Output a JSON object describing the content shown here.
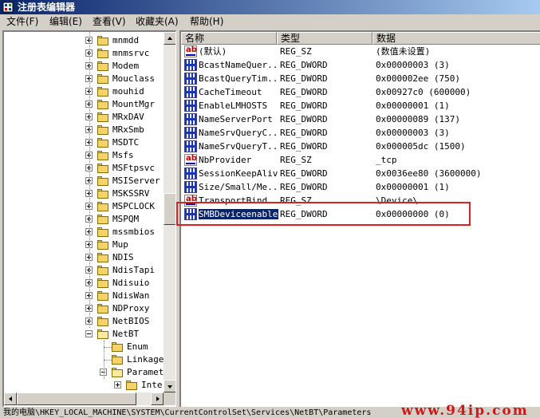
{
  "window": {
    "title": "注册表编辑器",
    "app_icon": "regedit-icon"
  },
  "menu": [
    "文件(F)",
    "编辑(E)",
    "查看(V)",
    "收藏夹(A)",
    "帮助(H)"
  ],
  "tree": {
    "items": [
      {
        "label": "mnmdd",
        "expander": "plus"
      },
      {
        "label": "mnmsrvc",
        "expander": "plus"
      },
      {
        "label": "Modem",
        "expander": "plus"
      },
      {
        "label": "Mouclass",
        "expander": "plus"
      },
      {
        "label": "mouhid",
        "expander": "plus"
      },
      {
        "label": "MountMgr",
        "expander": "plus"
      },
      {
        "label": "MRxDAV",
        "expander": "plus"
      },
      {
        "label": "MRxSmb",
        "expander": "plus"
      },
      {
        "label": "MSDTC",
        "expander": "plus"
      },
      {
        "label": "Msfs",
        "expander": "plus"
      },
      {
        "label": "MSFtpsvc",
        "expander": "plus"
      },
      {
        "label": "MSIServer",
        "expander": "plus"
      },
      {
        "label": "MSKSSRV",
        "expander": "plus"
      },
      {
        "label": "MSPCLOCK",
        "expander": "plus"
      },
      {
        "label": "MSPQM",
        "expander": "plus"
      },
      {
        "label": "mssmbios",
        "expander": "plus"
      },
      {
        "label": "Mup",
        "expander": "plus"
      },
      {
        "label": "NDIS",
        "expander": "plus"
      },
      {
        "label": "NdisTapi",
        "expander": "plus"
      },
      {
        "label": "Ndisuio",
        "expander": "plus"
      },
      {
        "label": "NdisWan",
        "expander": "plus"
      },
      {
        "label": "NDProxy",
        "expander": "plus"
      },
      {
        "label": "NetBIOS",
        "expander": "plus"
      },
      {
        "label": "NetBT",
        "expander": "minus"
      }
    ],
    "netbt_children": [
      {
        "label": "Enum",
        "expander": "none"
      },
      {
        "label": "Linkage",
        "expander": "none"
      },
      {
        "label": "Paramet",
        "expander": "minus"
      }
    ],
    "param_children": [
      {
        "label": "Inte",
        "expander": "plus"
      }
    ]
  },
  "list": {
    "columns": [
      "名称",
      "类型",
      "数据"
    ],
    "rows": [
      {
        "icon": "string-value-icon",
        "name": "(默认)",
        "type": "REG_SZ",
        "data": "(数值未设置)"
      },
      {
        "icon": "dword-value-icon",
        "name": "BcastNameQuer...",
        "type": "REG_DWORD",
        "data": "0x00000003 (3)"
      },
      {
        "icon": "dword-value-icon",
        "name": "BcastQueryTim...",
        "type": "REG_DWORD",
        "data": "0x000002ee (750)"
      },
      {
        "icon": "dword-value-icon",
        "name": "CacheTimeout",
        "type": "REG_DWORD",
        "data": "0x00927c0 (600000)"
      },
      {
        "icon": "dword-value-icon",
        "name": "EnableLMHOSTS",
        "type": "REG_DWORD",
        "data": "0x00000001 (1)"
      },
      {
        "icon": "dword-value-icon",
        "name": "NameServerPort",
        "type": "REG_DWORD",
        "data": "0x00000089 (137)"
      },
      {
        "icon": "dword-value-icon",
        "name": "NameSrvQueryC...",
        "type": "REG_DWORD",
        "data": "0x00000003 (3)"
      },
      {
        "icon": "dword-value-icon",
        "name": "NameSrvQueryT...",
        "type": "REG_DWORD",
        "data": "0x000005dc (1500)"
      },
      {
        "icon": "string-value-icon",
        "name": "NbProvider",
        "type": "REG_SZ",
        "data": "_tcp"
      },
      {
        "icon": "dword-value-icon",
        "name": "SessionKeepAlive",
        "type": "REG_DWORD",
        "data": "0x0036ee80 (3600000)"
      },
      {
        "icon": "dword-value-icon",
        "name": "Size/Small/Me...",
        "type": "REG_DWORD",
        "data": "0x00000001 (1)"
      },
      {
        "icon": "string-value-icon",
        "name": "TransportBind...",
        "type": "REG_SZ",
        "data": "\\Device\\"
      },
      {
        "icon": "dword-value-icon",
        "name": "SMBDeviceenabled",
        "type": "REG_DWORD",
        "data": "0x00000000 (0)",
        "selected": true
      }
    ]
  },
  "status": {
    "path": "我的电脑\\HKEY_LOCAL_MACHINE\\SYSTEM\\CurrentControlSet\\Services\\NetBT\\Parameters"
  },
  "watermark": "www.94ip.com",
  "colors": {
    "highlight_box": "#e02020",
    "selection": "#0a246a"
  }
}
